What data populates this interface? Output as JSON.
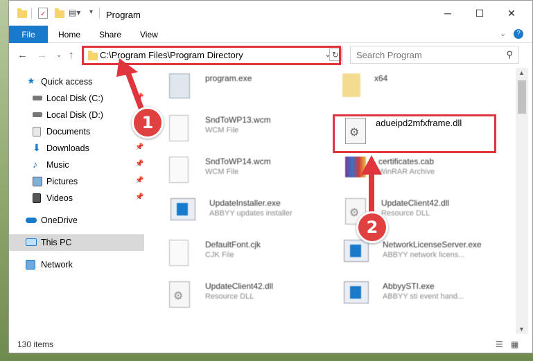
{
  "window": {
    "title": "Program"
  },
  "ribbon": {
    "tabs": [
      "File",
      "Home",
      "Share",
      "View"
    ]
  },
  "address": {
    "path": "C:\\Program Files\\Program Directory"
  },
  "search": {
    "placeholder": "Search Program"
  },
  "nav": {
    "items": [
      {
        "label": "Quick access",
        "icon": "star-icon",
        "pinned": false,
        "selected": false
      },
      {
        "label": "Local Disk (C:)",
        "icon": "drive-icon",
        "pinned": true,
        "selected": false
      },
      {
        "label": "Local Disk (D:)",
        "icon": "drive-icon",
        "pinned": true,
        "selected": false
      },
      {
        "label": "Documents",
        "icon": "documents-icon",
        "pinned": true,
        "selected": false
      },
      {
        "label": "Downloads",
        "icon": "download-icon",
        "pinned": true,
        "selected": false
      },
      {
        "label": "Music",
        "icon": "music-icon",
        "pinned": true,
        "selected": false
      },
      {
        "label": "Pictures",
        "icon": "pictures-icon",
        "pinned": true,
        "selected": false
      },
      {
        "label": "Videos",
        "icon": "videos-icon",
        "pinned": true,
        "selected": false
      },
      {
        "label": "OneDrive",
        "icon": "cloud-icon",
        "pinned": false,
        "selected": false
      },
      {
        "label": "This PC",
        "icon": "computer-icon",
        "pinned": false,
        "selected": true
      },
      {
        "label": "Network",
        "icon": "network-icon",
        "pinned": false,
        "selected": false
      }
    ]
  },
  "files": [
    {
      "name": "program.exe",
      "type": ""
    },
    {
      "name": "x64",
      "type": ""
    },
    {
      "name": "SndToWP13.wcm",
      "type": "WCM File"
    },
    {
      "name": "adueipd2mfxframe.dll",
      "type": ""
    },
    {
      "name": "SndToWP14.wcm",
      "type": "WCM File"
    },
    {
      "name": "certificates.cab",
      "type": "WinRAR Archive"
    },
    {
      "name": "UpdateInstaller.exe",
      "type": "ABBYY updates installer"
    },
    {
      "name": "UpdateClient42.dll",
      "type": "Resource DLL"
    },
    {
      "name": "DefaultFont.cjk",
      "type": "CJK File"
    },
    {
      "name": "NetworkLicenseServer.exe",
      "type": "ABBYY network licens..."
    },
    {
      "name": "UpdateClient42.dll",
      "type": "Resource DLL"
    },
    {
      "name": "AbbyySTI.exe",
      "type": "ABBYY sti event hand..."
    }
  ],
  "status": {
    "count": "130 items"
  },
  "annotations": {
    "step1": "1",
    "step2": "2"
  },
  "colors": {
    "accent": "#1979ca",
    "highlight": "#e0353c"
  }
}
